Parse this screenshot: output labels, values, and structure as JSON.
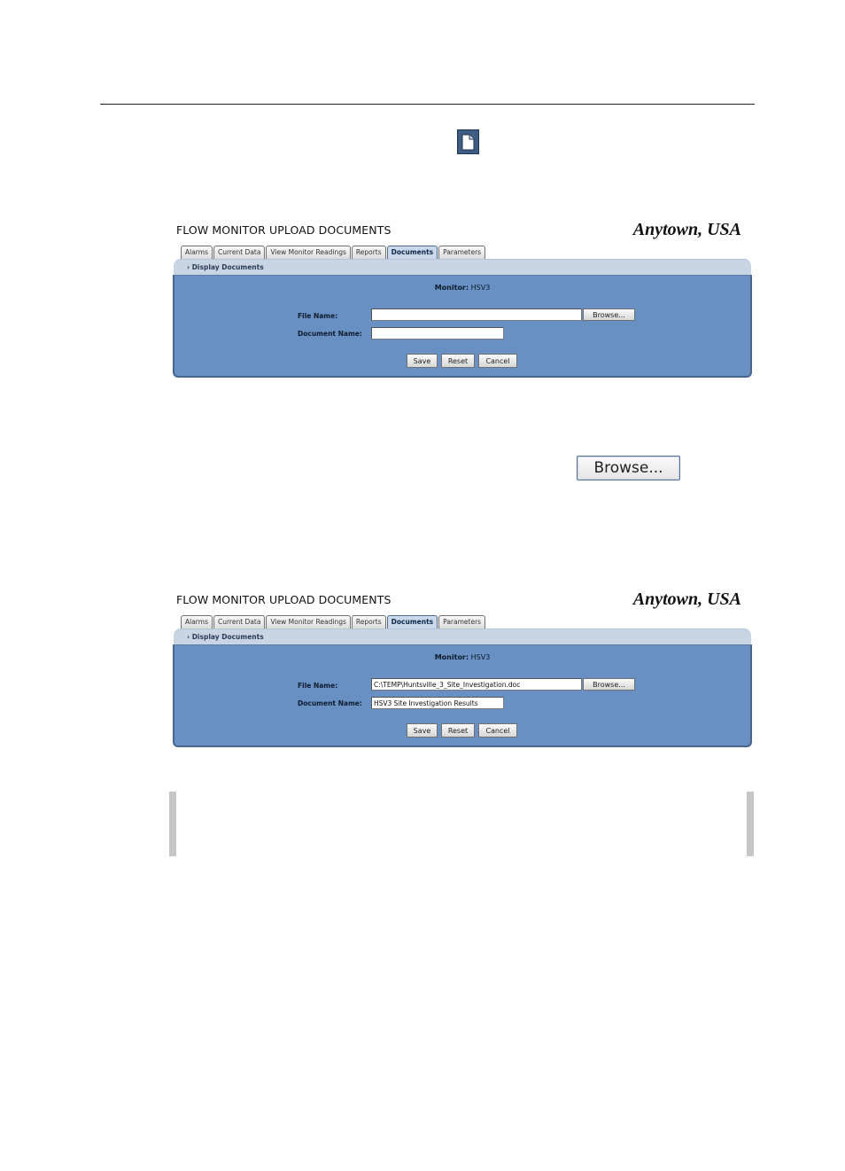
{
  "panels": [
    {
      "title": "FLOW MONITOR UPLOAD DOCUMENTS",
      "brand": "Anytown, USA",
      "tabs": [
        "Alarms",
        "Current Data",
        "View Monitor Readings",
        "Reports",
        "Documents",
        "Parameters"
      ],
      "active_tab": "Documents",
      "subnav_link": "› Display Documents",
      "monitor_label": "Monitor:",
      "monitor_value": "HSV3",
      "file_name_label": "File Name:",
      "file_name_value": "",
      "document_name_label": "Document Name:",
      "document_name_value": "",
      "browse_label": "Browse...",
      "save_label": "Save",
      "reset_label": "Reset",
      "cancel_label": "Cancel"
    },
    {
      "title": "FLOW MONITOR UPLOAD DOCUMENTS",
      "brand": "Anytown, USA",
      "tabs": [
        "Alarms",
        "Current Data",
        "View Monitor Readings",
        "Reports",
        "Documents",
        "Parameters"
      ],
      "active_tab": "Documents",
      "subnav_link": "› Display Documents",
      "monitor_label": "Monitor:",
      "monitor_value": "HSV3",
      "file_name_label": "File Name:",
      "file_name_value": "C:\\TEMP\\Huntsville_3_Site_Investigation.doc",
      "document_name_label": "Document Name:",
      "document_name_value": "HSV3 Site Investigation Results",
      "browse_label": "Browse...",
      "save_label": "Save",
      "reset_label": "Reset",
      "cancel_label": "Cancel"
    }
  ],
  "large_browse_button": {
    "label": "Browse..."
  },
  "icons": {
    "document": "document-icon"
  },
  "colors": {
    "panel_blue": "#6890c3",
    "subbar": "#c9d5e5",
    "note_bar": "#c6c6c6"
  }
}
